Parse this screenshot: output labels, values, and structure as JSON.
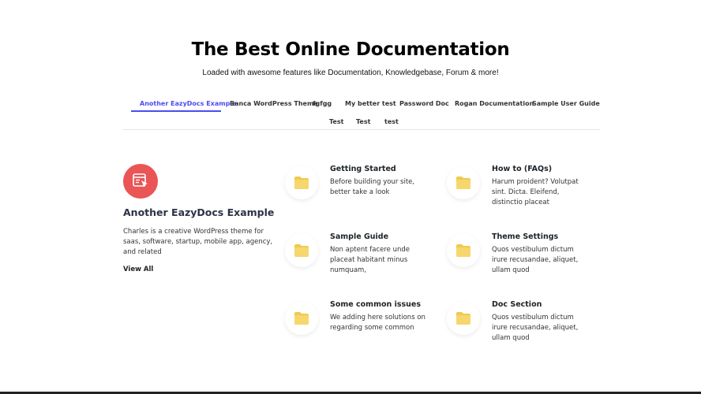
{
  "hero": {
    "title": "The Best Online Documentation",
    "subtitle": "Loaded with awesome features like Documentation, Knowledgebase, Forum & more!"
  },
  "tabs": [
    {
      "label": "Another EazyDocs Example",
      "active": true
    },
    {
      "label": "Banca WordPress Theme",
      "active": false
    },
    {
      "label": "fgfgg",
      "active": false
    },
    {
      "label": "My better test",
      "active": false
    },
    {
      "label": "Password Doc",
      "active": false
    },
    {
      "label": "Rogan Documentation",
      "active": false
    },
    {
      "label": "Sample User Guide",
      "active": false
    },
    {
      "label": "Test",
      "active": false
    },
    {
      "label": "Test",
      "active": false
    },
    {
      "label": "test",
      "active": false
    }
  ],
  "category": {
    "icon": "doc-cursor-icon",
    "title": "Another EazyDocs Example",
    "description": "Charles is a creative WordPress theme for saas, software, startup, mobile app, agency, and related",
    "view_all": "View All"
  },
  "docs": [
    {
      "title": "Getting Started",
      "description": "Before building your site, better take a look",
      "icon": "folder-icon"
    },
    {
      "title": "How to (FAQs)",
      "description": "Harum proident? Volutpat sint. Dicta. Eleifend, distinctio placeat",
      "icon": "folder-icon"
    },
    {
      "title": "Sample Guide",
      "description": "Non aptent facere unde placeat habitant minus numquam,",
      "icon": "folder-icon"
    },
    {
      "title": "Theme Settings",
      "description": "Quos vestibulum dictum irure recusandae, aliquet, ullam quod",
      "icon": "folder-icon"
    },
    {
      "title": "Some common issues",
      "description": "We adding here solutions on regarding some common",
      "icon": "folder-icon"
    },
    {
      "title": "Doc Section",
      "description": "Quos vestibulum dictum irure recusandae, aliquet, ullam quod",
      "icon": "folder-icon"
    }
  ],
  "colors": {
    "accent": "#4c4cf1",
    "category_icon_bg": "#ea5555",
    "folder": "#f2c94c"
  }
}
